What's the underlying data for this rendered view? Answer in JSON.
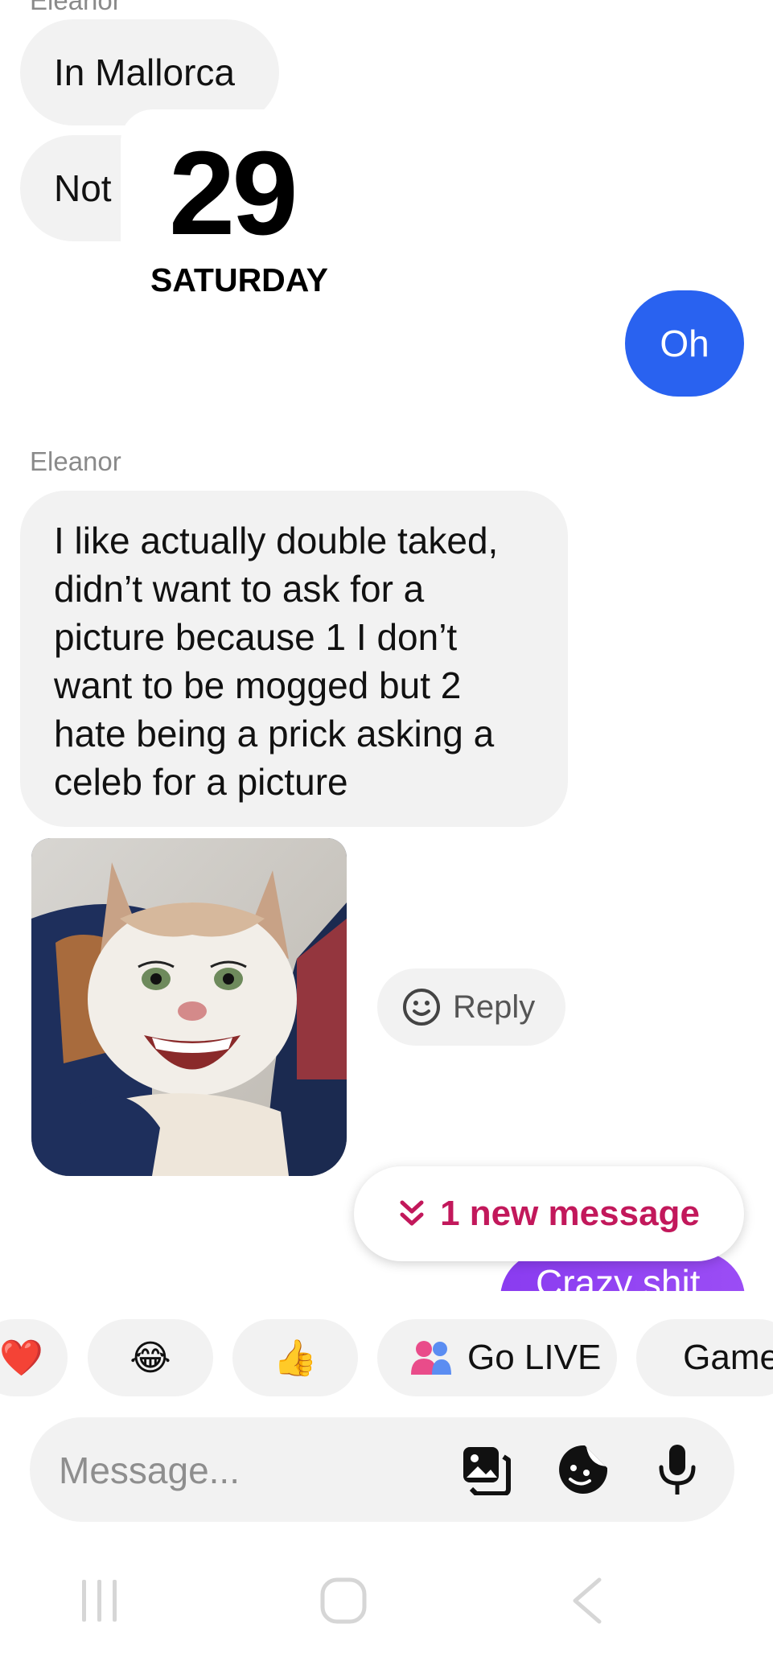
{
  "messages": {
    "cut_sender": "Eleanor",
    "msg1": "In Mallorca",
    "msg2": "Not",
    "date_number": "29",
    "date_day": "SATURDAY",
    "outgoing1": "Oh",
    "sender": "Eleanor",
    "long_lines": [
      "I like actually double taked,",
      "didn’t want to ask for a",
      "picture because 1 I don’t",
      "want to be mogged but 2",
      "hate being a prick asking a",
      "celeb for a picture"
    ],
    "reply_label": "Reply",
    "new_message_label": "1 new message",
    "outgoing2": "Crazy shit"
  },
  "quick_actions": {
    "heart": "❤️",
    "laugh": "😂",
    "thumbs": "👍",
    "go_live": "Go LIVE",
    "games": "Games"
  },
  "composer": {
    "placeholder": "Message..."
  },
  "icons": {
    "go_live": "people-icon",
    "games": "gamepad-icon",
    "gallery": "gallery-icon",
    "sticker": "sticker-icon",
    "mic": "microphone-icon",
    "reply": "smiley-icon"
  },
  "colors": {
    "outgoing_blue": "#2962f0",
    "outgoing_purple": "#8a3cf0",
    "new_message": "#c2185b",
    "bubble_gray": "#f2f2f2"
  }
}
